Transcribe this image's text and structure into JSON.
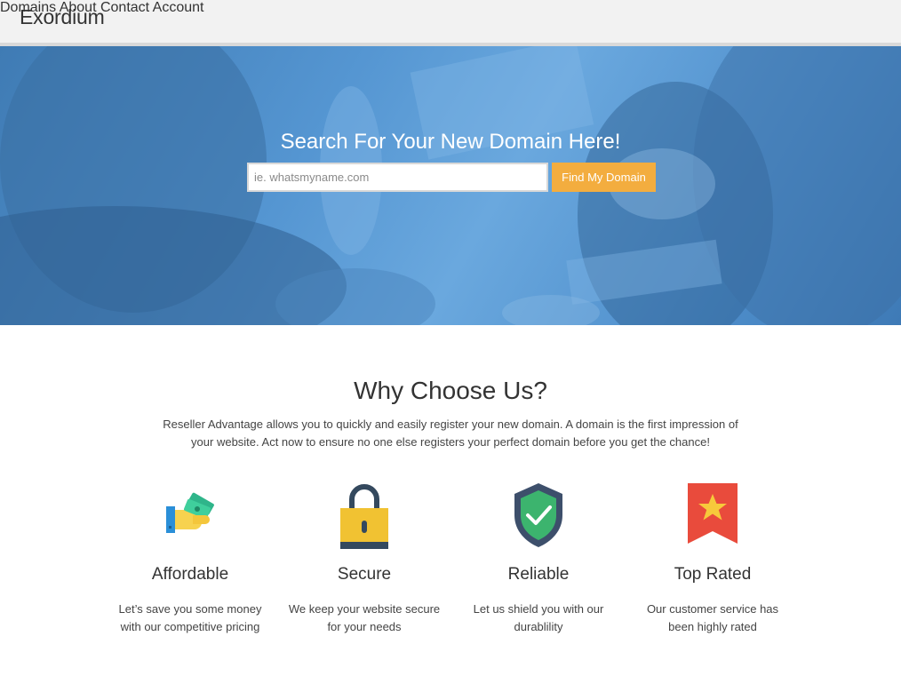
{
  "header": {
    "brand": "Exordium",
    "nav": [
      {
        "label": "Domains"
      },
      {
        "label": "About"
      },
      {
        "label": "Contact"
      },
      {
        "label": "Account"
      }
    ]
  },
  "hero": {
    "title": "Search For Your New Domain Here!",
    "search_placeholder": "ie. whatsmyname.com",
    "search_value": "",
    "button_label": "Find My Domain"
  },
  "why": {
    "title": "Why Choose Us?",
    "text": "Reseller Advantage allows you to quickly and easily register your new domain. A domain is the first impression of your website. Act now to ensure no one else registers your perfect domain before you get the chance!"
  },
  "features": [
    {
      "icon": "money-hand-icon",
      "title": "Affordable",
      "desc": "Let’s save you some money with our competitive pricing"
    },
    {
      "icon": "padlock-icon",
      "title": "Secure",
      "desc": "We keep your website secure for your needs"
    },
    {
      "icon": "shield-check-icon",
      "title": "Reliable",
      "desc": "Let us shield you with our durablility"
    },
    {
      "icon": "star-ribbon-icon",
      "title": "Top Rated",
      "desc": "Our customer service has been highly rated"
    }
  ],
  "colors": {
    "accent_button": "#f3ad3f",
    "hero_overlay": "#5b9bd5",
    "header_bg": "#f2f2f2"
  }
}
